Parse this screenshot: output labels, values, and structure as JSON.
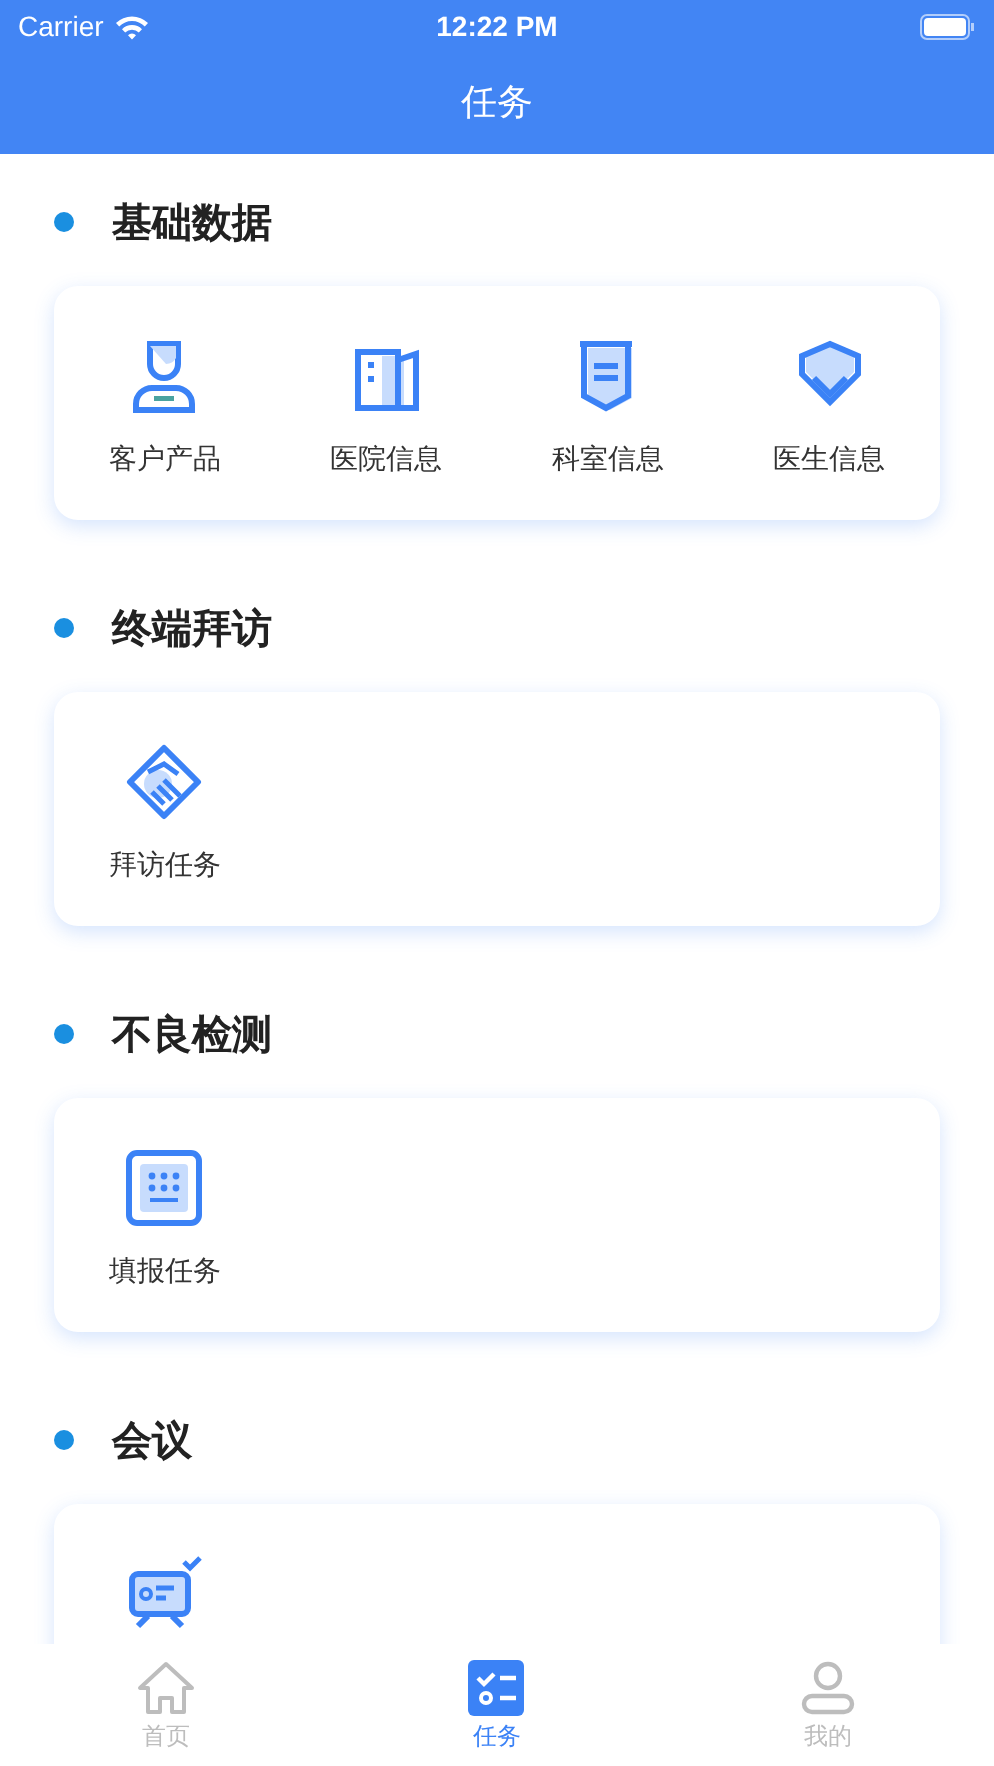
{
  "status_bar": {
    "carrier": "Carrier",
    "time": "12:22 PM"
  },
  "nav_bar": {
    "title": "任务"
  },
  "sections": [
    {
      "title": "基础数据",
      "items": [
        {
          "kind": "tile",
          "label": "客户产品"
        },
        {
          "kind": "tile",
          "label": "医院信息"
        },
        {
          "kind": "tile",
          "label": "科室信息"
        },
        {
          "kind": "tile",
          "label": "医生信息"
        }
      ]
    },
    {
      "title": "终端拜访",
      "items": [
        {
          "kind": "tile",
          "label": "拜访任务"
        }
      ]
    },
    {
      "title": "不良检测",
      "items": [
        {
          "kind": "tile",
          "label": "填报任务"
        }
      ]
    },
    {
      "title": "会议",
      "items": [
        {
          "kind": "icon_only"
        }
      ]
    }
  ],
  "tab_bar": [
    {
      "label": "首页",
      "selected": false
    },
    {
      "label": "任务",
      "selected": true
    },
    {
      "label": "我的",
      "selected": false
    }
  ]
}
